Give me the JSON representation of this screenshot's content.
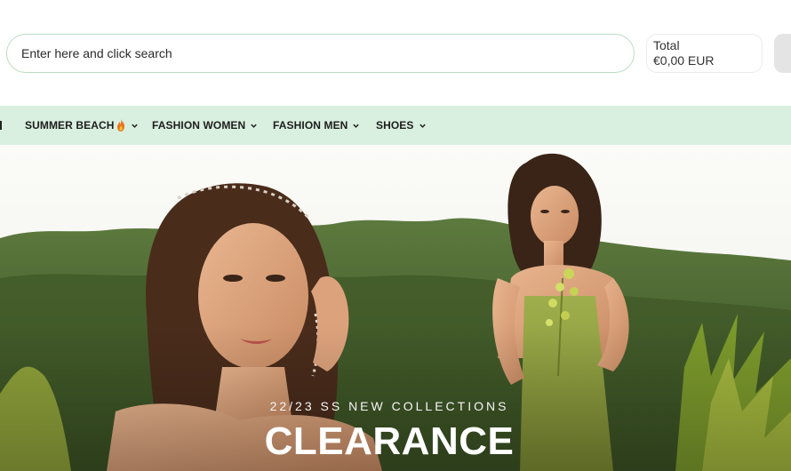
{
  "search": {
    "placeholder": "Enter here and click search"
  },
  "cart": {
    "total_label": "Total",
    "total_value": "€0,00 EUR"
  },
  "nav": {
    "items": [
      {
        "label": "SUMMER BEACH",
        "icon": "flame-icon"
      },
      {
        "label": "FASHION WOMEN"
      },
      {
        "label": "FASHION MEN"
      },
      {
        "label": "SHOES"
      }
    ]
  },
  "hero": {
    "subtitle": "22/23 SS NEW COLLECTIONS",
    "title": "CLEARANCE"
  },
  "colors": {
    "nav_background": "#d9efdf",
    "search_border": "#b9dcc3"
  }
}
